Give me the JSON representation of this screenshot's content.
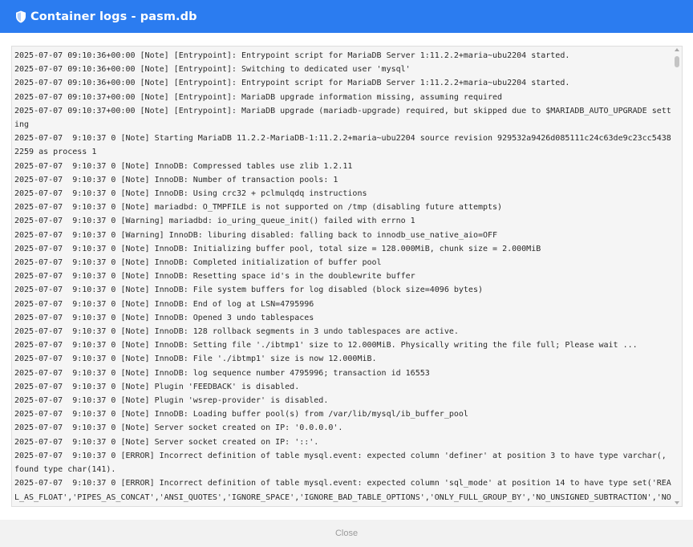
{
  "window": {
    "title": "Container logs - pasm.db",
    "icon": "shield-icon",
    "accent_color": "#2b7cf0"
  },
  "log": {
    "lines": [
      "2025-07-07 09:10:36+00:00 [Note] [Entrypoint]: Entrypoint script for MariaDB Server 1:11.2.2+maria~ubu2204 started.",
      "2025-07-07 09:10:36+00:00 [Note] [Entrypoint]: Switching to dedicated user 'mysql'",
      "2025-07-07 09:10:36+00:00 [Note] [Entrypoint]: Entrypoint script for MariaDB Server 1:11.2.2+maria~ubu2204 started.",
      "2025-07-07 09:10:37+00:00 [Note] [Entrypoint]: MariaDB upgrade information missing, assuming required",
      "2025-07-07 09:10:37+00:00 [Note] [Entrypoint]: MariaDB upgrade (mariadb-upgrade) required, but skipped due to $MARIADB_AUTO_UPGRADE setting",
      "2025-07-07  9:10:37 0 [Note] Starting MariaDB 11.2.2-MariaDB-1:11.2.2+maria~ubu2204 source revision 929532a9426d085111c24c63de9c23cc54382259 as process 1",
      "2025-07-07  9:10:37 0 [Note] InnoDB: Compressed tables use zlib 1.2.11",
      "2025-07-07  9:10:37 0 [Note] InnoDB: Number of transaction pools: 1",
      "2025-07-07  9:10:37 0 [Note] InnoDB: Using crc32 + pclmulqdq instructions",
      "2025-07-07  9:10:37 0 [Note] mariadbd: O_TMPFILE is not supported on /tmp (disabling future attempts)",
      "2025-07-07  9:10:37 0 [Warning] mariadbd: io_uring_queue_init() failed with errno 1",
      "2025-07-07  9:10:37 0 [Warning] InnoDB: liburing disabled: falling back to innodb_use_native_aio=OFF",
      "2025-07-07  9:10:37 0 [Note] InnoDB: Initializing buffer pool, total size = 128.000MiB, chunk size = 2.000MiB",
      "2025-07-07  9:10:37 0 [Note] InnoDB: Completed initialization of buffer pool",
      "2025-07-07  9:10:37 0 [Note] InnoDB: Resetting space id's in the doublewrite buffer",
      "2025-07-07  9:10:37 0 [Note] InnoDB: File system buffers for log disabled (block size=4096 bytes)",
      "2025-07-07  9:10:37 0 [Note] InnoDB: End of log at LSN=4795996",
      "2025-07-07  9:10:37 0 [Note] InnoDB: Opened 3 undo tablespaces",
      "2025-07-07  9:10:37 0 [Note] InnoDB: 128 rollback segments in 3 undo tablespaces are active.",
      "2025-07-07  9:10:37 0 [Note] InnoDB: Setting file './ibtmp1' size to 12.000MiB. Physically writing the file full; Please wait ...",
      "2025-07-07  9:10:37 0 [Note] InnoDB: File './ibtmp1' size is now 12.000MiB.",
      "2025-07-07  9:10:37 0 [Note] InnoDB: log sequence number 4795996; transaction id 16553",
      "2025-07-07  9:10:37 0 [Note] Plugin 'FEEDBACK' is disabled.",
      "2025-07-07  9:10:37 0 [Note] Plugin 'wsrep-provider' is disabled.",
      "2025-07-07  9:10:37 0 [Note] InnoDB: Loading buffer pool(s) from /var/lib/mysql/ib_buffer_pool",
      "2025-07-07  9:10:37 0 [Note] Server socket created on IP: '0.0.0.0'.",
      "2025-07-07  9:10:37 0 [Note] Server socket created on IP: '::'.",
      "2025-07-07  9:10:37 0 [ERROR] Incorrect definition of table mysql.event: expected column 'definer' at position 3 to have type varchar(, found type char(141).",
      "2025-07-07  9:10:37 0 [ERROR] Incorrect definition of table mysql.event: expected column 'sql_mode' at position 14 to have type set('REAL_AS_FLOAT','PIPES_AS_CONCAT','ANSI_QUOTES','IGNORE_SPACE','IGNORE_BAD_TABLE_OPTIONS','ONLY_FULL_GROUP_BY','NO_UNSIGNED_SUBTRACTION','NO_DIR"
    ]
  },
  "footer": {
    "close_label": "Close"
  }
}
